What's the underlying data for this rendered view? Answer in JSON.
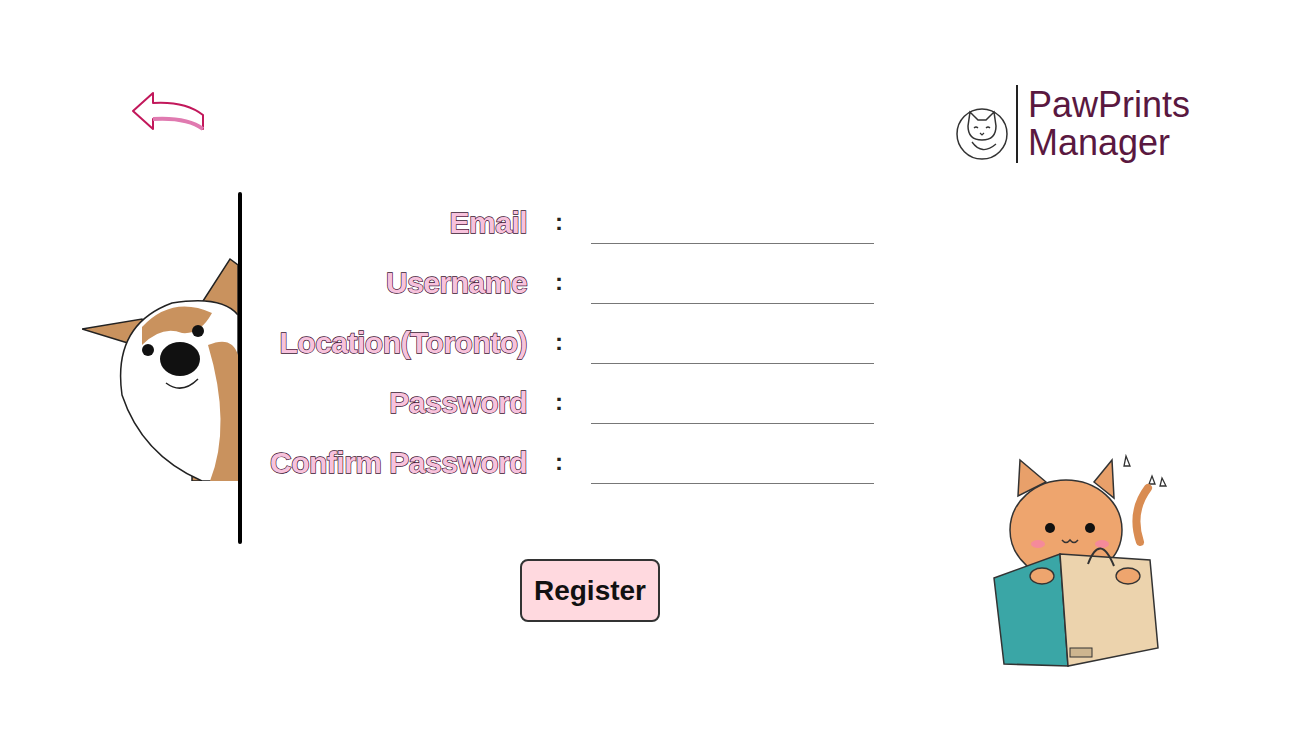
{
  "header": {
    "logo": {
      "line1": "PawPrints",
      "line2": "Manager"
    }
  },
  "form": {
    "fields": [
      {
        "label": "Email",
        "separator": ":"
      },
      {
        "label": "Username",
        "separator": ":"
      },
      {
        "label": "Location(Toronto)",
        "separator": ":"
      },
      {
        "label": "Password",
        "separator": ":"
      },
      {
        "label": "Confirm Password",
        "separator": ":"
      }
    ]
  },
  "buttons": [
    "Register"
  ]
}
